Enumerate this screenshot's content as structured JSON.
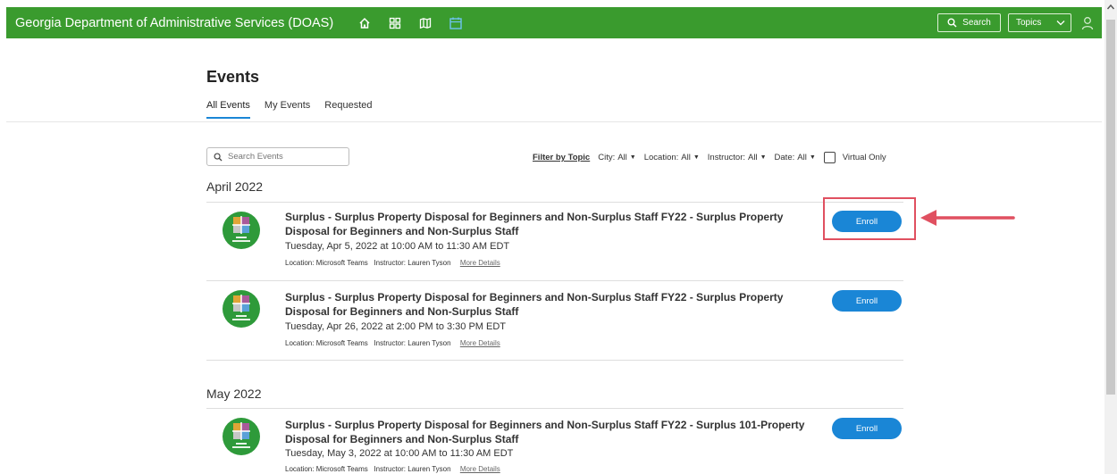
{
  "header": {
    "brand": "Georgia Department of Administrative Services (DOAS)",
    "nav_icons": [
      "home-icon",
      "grid-icon",
      "map-icon",
      "calendar-icon"
    ],
    "search_label": "Search",
    "topics_label": "Topics"
  },
  "page": {
    "title": "Events",
    "tabs": [
      {
        "label": "All Events",
        "active": true
      },
      {
        "label": "My Events",
        "active": false
      },
      {
        "label": "Requested",
        "active": false
      }
    ]
  },
  "filters": {
    "search_placeholder": "Search Events",
    "filter_by_topic": "Filter by Topic",
    "city_label": "City:",
    "city_value": "All",
    "location_label": "Location:",
    "location_value": "All",
    "instructor_label": "Instructor:",
    "instructor_value": "All",
    "date_label": "Date:",
    "date_value": "All",
    "virtual_only": "Virtual Only"
  },
  "sections": [
    {
      "month": "April 2022",
      "events": [
        {
          "title": "Surplus - Surplus Property Disposal for Beginners and Non-Surplus Staff FY22 - Surplus Property Disposal for Beginners and Non-Surplus Staff",
          "date": "Tuesday, Apr 5, 2022 at 10:00 AM to 11:30 AM EDT",
          "location": "Location: Microsoft Teams",
          "instructor": "Instructor: Lauren Tyson",
          "more": "More Details",
          "enroll": "Enroll"
        },
        {
          "title": "Surplus - Surplus Property Disposal for Beginners and Non-Surplus Staff FY22 - Surplus Property Disposal for Beginners and Non-Surplus Staff",
          "date": "Tuesday, Apr 26, 2022 at 2:00 PM to 3:30 PM EDT",
          "location": "Location: Microsoft Teams",
          "instructor": "Instructor: Lauren Tyson",
          "more": "More Details",
          "enroll": "Enroll"
        }
      ]
    },
    {
      "month": "May 2022",
      "events": [
        {
          "title": "Surplus - Surplus Property Disposal for Beginners and Non-Surplus Staff FY22 - Surplus 101-Property Disposal for Beginners and Non-Surplus Staff",
          "date": "Tuesday, May 3, 2022 at 10:00 AM to 11:30 AM EDT",
          "location": "Location: Microsoft Teams",
          "instructor": "Instructor: Lauren Tyson",
          "more": "More Details",
          "enroll": "Enroll"
        }
      ]
    }
  ],
  "colors": {
    "topbar": "#3a9b2e",
    "accent": "#1a86d6",
    "annotation": "#e05060"
  }
}
